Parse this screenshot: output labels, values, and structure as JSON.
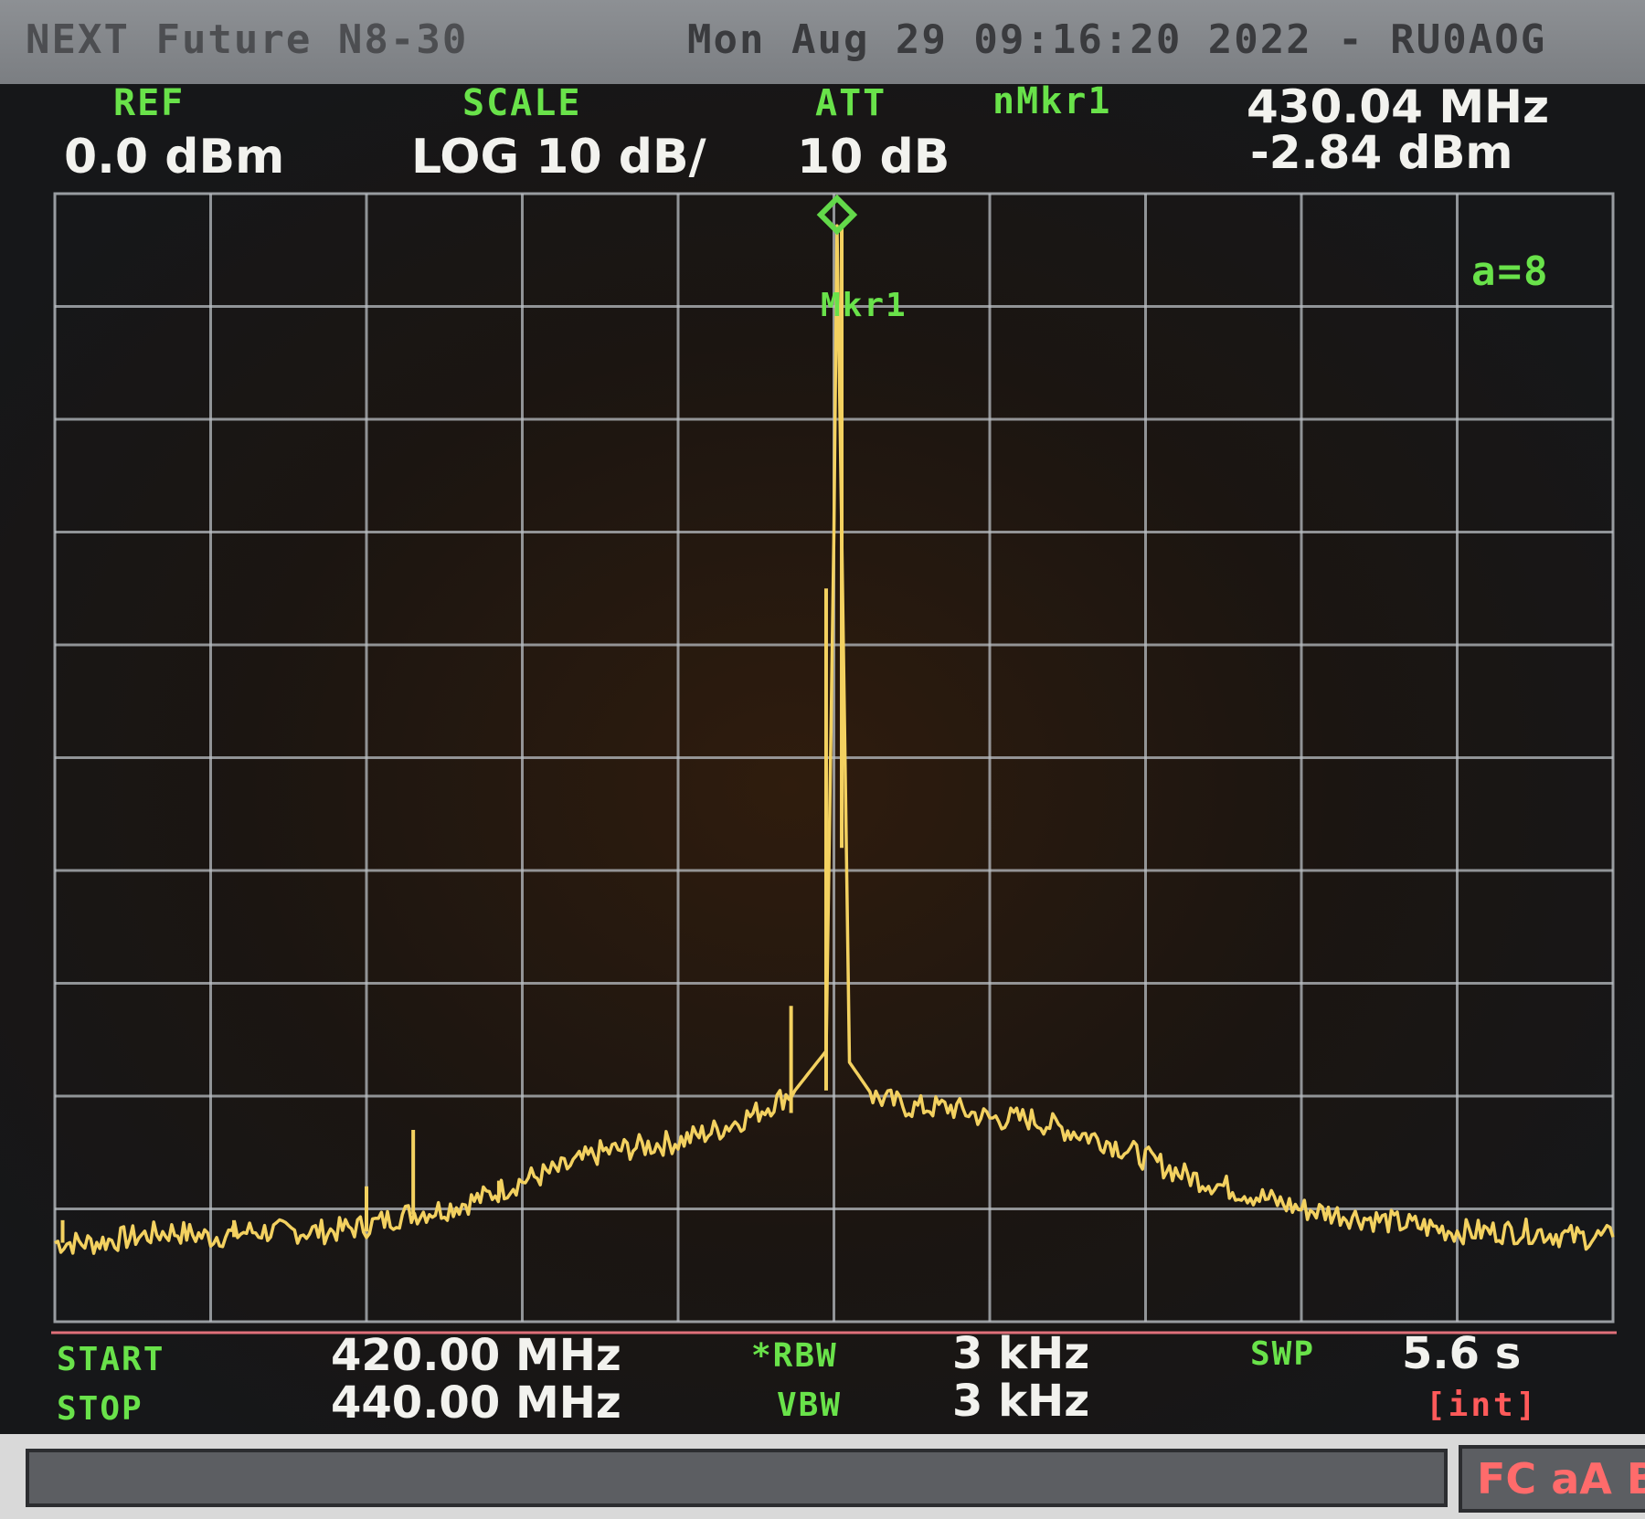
{
  "window": {
    "app_title": "NEXT Future N8-30",
    "timestamp": "Mon Aug 29 09:16:20 2022 - RU0AOG"
  },
  "header": {
    "ref_label": "REF",
    "ref_value": "0.0 dBm",
    "scale_label": "SCALE",
    "scale_value": "LOG 10 dB/",
    "att_label": "ATT",
    "att_value": "10 dB",
    "marker_label": "nMkr1",
    "marker_freq": "430.04 MHz",
    "marker_level": "-2.84 dBm"
  },
  "plot": {
    "marker_tag": "Mkr1",
    "avg_badge": "a=8",
    "colors": {
      "trace": "#f3d160",
      "grid": "#b9bec3",
      "marker": "#63d94a",
      "labels": "#69e24a"
    }
  },
  "footer": {
    "start_label": "START",
    "start_value": "420.00 MHz",
    "stop_label": "STOP",
    "stop_value": "440.00 MHz",
    "rbw_label": "*RBW",
    "rbw_value": "3 kHz",
    "vbw_label": "VBW",
    "vbw_value": "3 kHz",
    "swp_label": "SWP",
    "swp_value": "5.6 s",
    "swp_mode": "[int]"
  },
  "status": {
    "indicators": "FC aA B"
  },
  "chart_data": {
    "type": "line",
    "x_unit": "MHz",
    "y_unit": "dBm",
    "xlim": [
      420,
      440
    ],
    "ylim": [
      -100,
      0
    ],
    "x_divisions": 10,
    "y_divisions": 10,
    "series": [
      {
        "x": [
          420.0,
          420.5,
          421.0,
          421.5,
          422.0,
          422.5,
          423.0,
          423.5,
          424.0,
          424.5,
          425.0,
          425.5,
          426.0,
          426.5,
          427.0,
          427.5,
          428.0,
          428.5,
          429.0,
          429.5,
          429.9,
          430.0,
          430.04,
          430.1,
          430.2,
          430.5,
          431.0,
          431.5,
          432.0,
          432.5,
          433.0,
          433.5,
          434.0,
          434.5,
          435.0,
          435.5,
          436.0,
          436.5,
          437.0,
          437.5,
          438.0,
          438.5,
          439.0,
          439.5,
          440.0
        ],
        "y": [
          -93,
          -93,
          -92.5,
          -92,
          -92.5,
          -92,
          -92,
          -92,
          -91.5,
          -90.5,
          -90,
          -89,
          -87.5,
          -86.5,
          -85,
          -84.5,
          -84,
          -83,
          -81.5,
          -79.5,
          -76,
          -30,
          -2.84,
          -30,
          -77,
          -80,
          -81,
          -81,
          -82,
          -82,
          -83,
          -84,
          -85.5,
          -87,
          -88,
          -89,
          -90,
          -90.5,
          -91,
          -91.5,
          -92,
          -92,
          -92,
          -92.5,
          -92.5
        ]
      }
    ],
    "spurs": [
      {
        "x": 420.1,
        "y": -91
      },
      {
        "x": 422.3,
        "y": -91
      },
      {
        "x": 424.0,
        "y": -88
      },
      {
        "x": 424.6,
        "y": -83
      },
      {
        "x": 425.7,
        "y": -87.5
      },
      {
        "x": 429.45,
        "y": -72
      },
      {
        "x": 429.9,
        "y": -35
      },
      {
        "x": 430.1,
        "y": -58
      }
    ],
    "marker": {
      "x": 430.04,
      "y": -2.84,
      "label": "Mkr1"
    }
  }
}
